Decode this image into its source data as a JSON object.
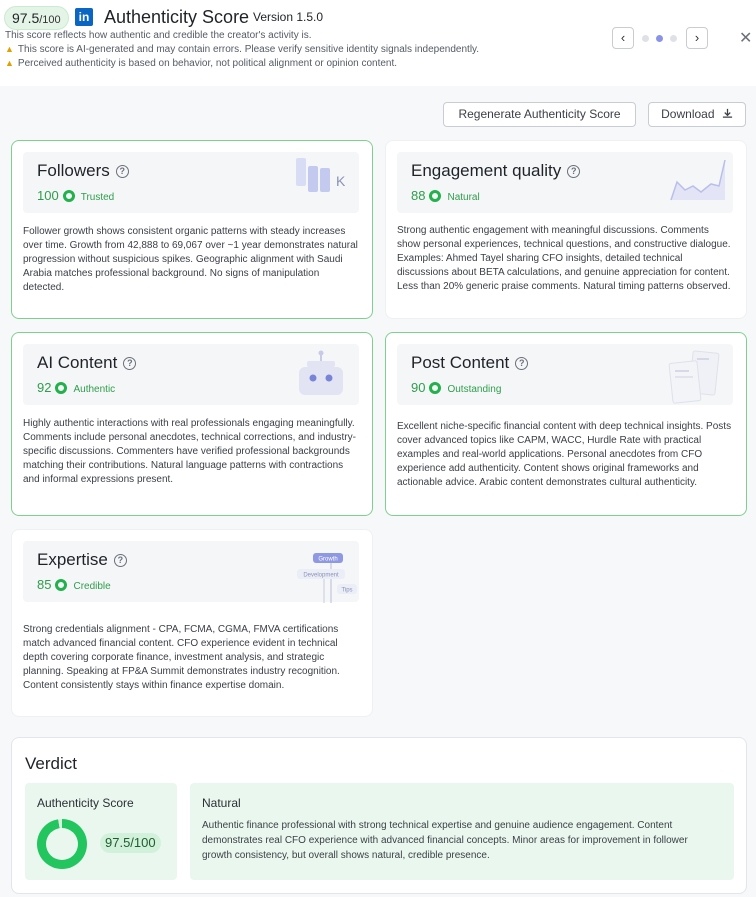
{
  "header": {
    "score_value": "97.5",
    "score_max": "/100",
    "logo_text": "in",
    "title": "Authenticity Score",
    "version": "Version 1.5.0",
    "subtitle": "This score reflects how authentic and credible the creator's activity is.",
    "warnings": [
      "This score is AI-generated and may contain errors. Please verify sensitive identity signals independently.",
      "Perceived authenticity is based on behavior, not political alignment or opinion content."
    ],
    "nav": {
      "prev": "‹",
      "next": "›",
      "close": "✕",
      "active_dot": 2,
      "dot_count": 3
    }
  },
  "actions": {
    "regenerate_label": "Regenerate Authenticity Score",
    "download_label": "Download"
  },
  "cards": [
    {
      "title": "Followers",
      "score": "100",
      "status": "Trusted",
      "description": "Follower growth shows consistent organic patterns with steady increases over time. Growth from 42,888 to 69,067 over ~1 year demonstrates natural progression without suspicious spikes. Geographic alignment with Saudi Arabia matches professional background. No signs of manipulation detected.",
      "illustration_text": "K"
    },
    {
      "title": "Engagement quality",
      "score": "88",
      "status": "Natural",
      "description": "Strong authentic engagement with meaningful discussions. Comments show personal experiences, technical questions, and constructive dialogue. Examples: Ahmed Tayel sharing CFO insights, detailed technical discussions about BETA calculations, and genuine appreciation for content. Less than 20% generic praise comments. Natural timing patterns observed."
    },
    {
      "title": "AI Content",
      "score": "92",
      "status": "Authentic",
      "description": "Highly authentic interactions with real professionals engaging meaningfully. Comments include personal anecdotes, technical corrections, and industry-specific discussions. Commenters have verified professional backgrounds matching their contributions. Natural language patterns with contractions and informal expressions present."
    },
    {
      "title": "Post Content",
      "score": "90",
      "status": "Outstanding",
      "description": "Excellent niche-specific financial content with deep technical insights. Posts cover advanced topics like CAPM, WACC, Hurdle Rate with practical examples and real-world applications. Personal anecdotes from CFO experience add authenticity. Content shows original frameworks and actionable advice. Arabic content demonstrates cultural authenticity."
    },
    {
      "title": "Expertise",
      "score": "85",
      "status": "Credible",
      "description": "Strong credentials alignment - CPA, FCMA, CGMA, FMVA certifications match advanced financial content. CFO experience evident in technical depth covering corporate finance, investment analysis, and strategic planning. Speaking at FP&A Summit demonstrates industry recognition. Content consistently stays within finance expertise domain.",
      "illustration_tags": [
        "Growth",
        "Development",
        "Tips"
      ]
    }
  ],
  "verdict": {
    "title": "Verdict",
    "score_label": "Authenticity Score",
    "score_text": "97.5/100",
    "score_fraction": 0.975,
    "summary_title": "Natural",
    "summary": "Authentic finance professional with strong technical expertise and genuine audience engagement. Content demonstrates real CFO experience with advanced financial concepts. Minor areas for improvement in follower growth consistency, but overall shows natural, credible presence."
  },
  "colors": {
    "accent_green": "#22c55e",
    "card_border_green": "#7fd08f",
    "linkedin_blue": "#0a66c2",
    "warning_yellow": "#e0a100"
  }
}
